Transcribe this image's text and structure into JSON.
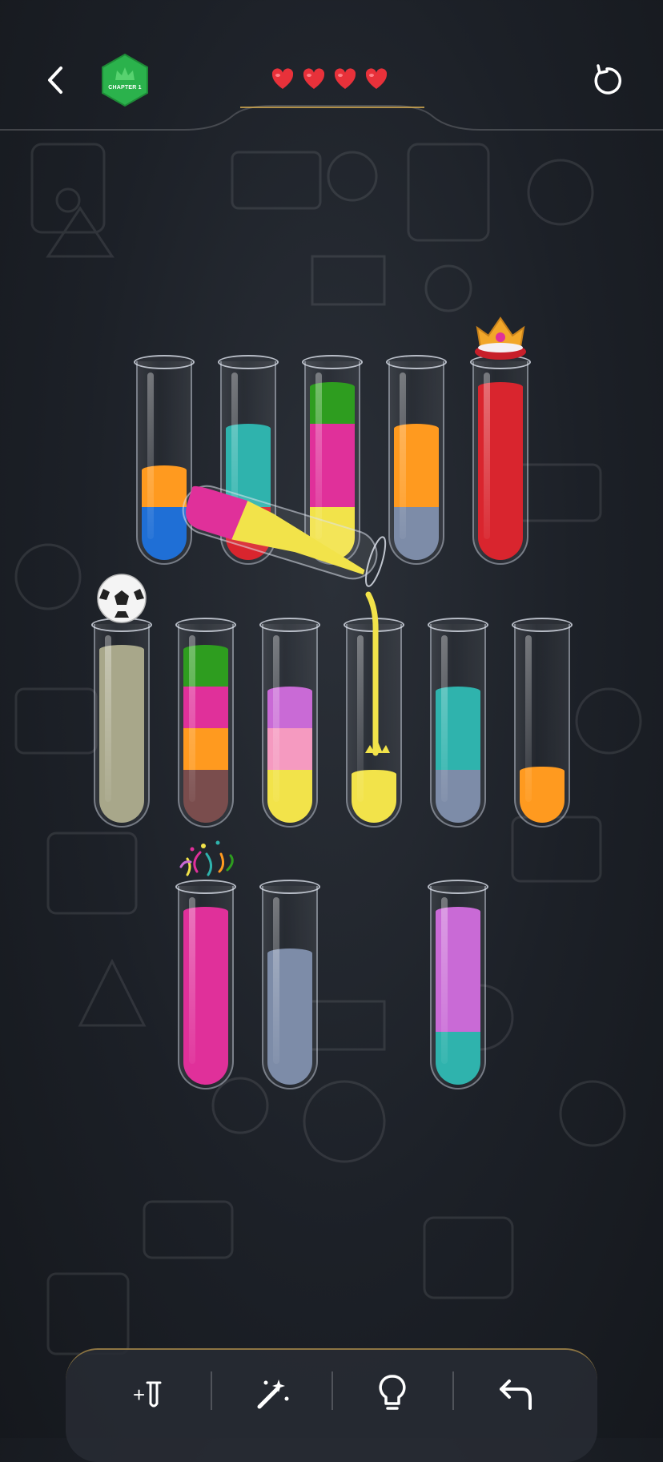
{
  "header": {
    "chapter_label": "CHAPTER 1",
    "lives": 4,
    "icons": {
      "back": "back-arrow-icon",
      "restart": "restart-icon",
      "chapter": "crown-hexagon-badge",
      "life": "heart-icon"
    }
  },
  "colors": {
    "heart": "#e8313a",
    "badge": "#2bb24c",
    "accent_gold": "#d4aa50",
    "liquids": {
      "orange": "#ff9a1f",
      "blue": "#1f6fd6",
      "teal": "#2fb3ad",
      "red": "#d9252e",
      "green": "#2e9d1f",
      "magenta": "#e0309a",
      "yellow": "#f2e34a",
      "slate": "#7d8ca8",
      "olive": "#a8a78a",
      "brown": "#7a4d4d",
      "purple": "#c96ad6",
      "pink": "#f59ac0"
    }
  },
  "tubes": {
    "row1": [
      {
        "id": "tube-1",
        "layers": [
          "blue",
          "orange"
        ]
      },
      {
        "id": "tube-2",
        "layers": [
          "red",
          "teal",
          "teal"
        ]
      },
      {
        "id": "tube-3",
        "layers": [
          "yellow",
          "magenta",
          "magenta",
          "green"
        ]
      },
      {
        "id": "tube-4",
        "layers": [
          "slate",
          "orange",
          "orange"
        ]
      },
      {
        "id": "tube-5",
        "layers": [
          "red",
          "red",
          "red",
          "red"
        ],
        "topper": "crown-icon"
      }
    ],
    "row2": [
      {
        "id": "tube-6",
        "layers": [
          "olive",
          "olive",
          "olive",
          "olive"
        ],
        "topper": "soccer-ball-icon"
      },
      {
        "id": "tube-7",
        "layers": [
          "brown",
          "orange",
          "magenta",
          "green"
        ]
      },
      {
        "id": "tube-8",
        "layers": [
          "yellow",
          "pink",
          "purple"
        ]
      },
      {
        "id": "tube-9",
        "layers": [
          "yellow"
        ]
      },
      {
        "id": "tube-10",
        "layers": [
          "slate",
          "teal",
          "teal"
        ]
      },
      {
        "id": "tube-11",
        "layers": [
          "orange"
        ]
      }
    ],
    "row3": [
      {
        "id": "tube-12",
        "layers": [
          "magenta",
          "magenta",
          "magenta",
          "magenta"
        ],
        "topper": "confetti-icon"
      },
      {
        "id": "tube-13",
        "layers": [
          "slate",
          "slate",
          "slate"
        ]
      },
      {
        "id": "tube-14",
        "layers": [
          "teal",
          "purple",
          "purple",
          "purple"
        ]
      }
    ],
    "pouring_tube": {
      "layers": [
        "magenta",
        "yellow"
      ],
      "target": "tube-9"
    }
  },
  "toolbar": {
    "items": [
      {
        "name": "add-tube-button",
        "icon": "add-tube-icon",
        "label": "+"
      },
      {
        "name": "magic-wand-button",
        "icon": "magic-wand-icon"
      },
      {
        "name": "hint-button",
        "icon": "lightbulb-icon"
      },
      {
        "name": "undo-button",
        "icon": "undo-icon"
      }
    ]
  }
}
